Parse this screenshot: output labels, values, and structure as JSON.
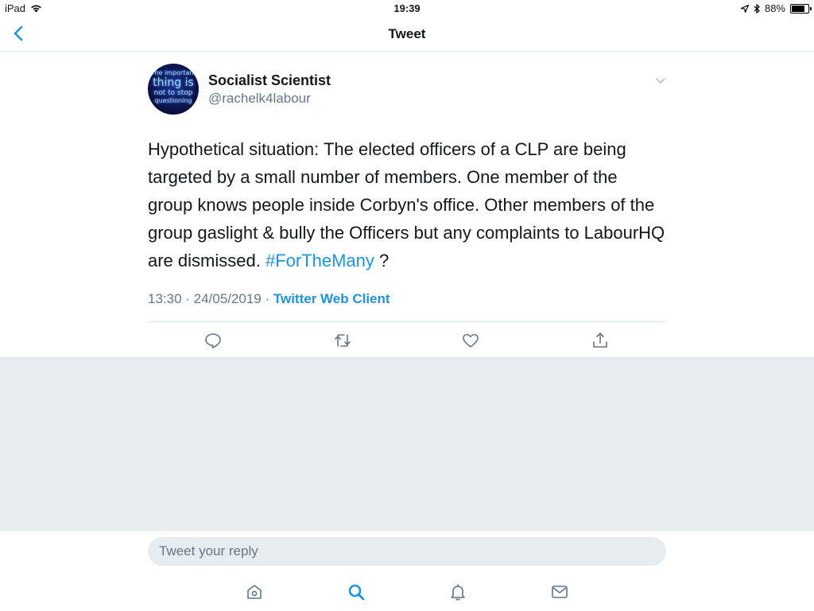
{
  "status_bar": {
    "device": "iPad",
    "time": "19:39",
    "battery_percent": "88%",
    "battery_level": 0.88
  },
  "nav": {
    "title": "Tweet",
    "back_icon": "chevron-left-icon"
  },
  "tweet": {
    "avatar_text": [
      "The important",
      "thing is",
      "not to stop",
      "questioning"
    ],
    "display_name": "Socialist Scientist",
    "handle": "@rachelk4labour",
    "text_main": "Hypothetical situation: The elected officers of a CLP are being targeted by a small number of members. One member of the group knows people inside Corbyn's office. Other members of the group gaslight & bully the Officers but any complaints to LabourHQ are dismissed. ",
    "hashtag": "#ForTheMany",
    "text_end": " ?",
    "timestamp": "13:30 · 24/05/2019 · ",
    "client": "Twitter Web Client",
    "actions": [
      "reply-icon",
      "retweet-icon",
      "like-icon",
      "share-icon"
    ]
  },
  "reply": {
    "placeholder": "Tweet your reply"
  },
  "tab_bar": {
    "tabs": [
      "home-icon",
      "search-icon",
      "notifications-icon",
      "messages-icon"
    ],
    "active": "search-icon"
  },
  "colors": {
    "accent": "#1b95e0",
    "secondary_text": "#657786",
    "background_grey": "#e6ecf0"
  }
}
